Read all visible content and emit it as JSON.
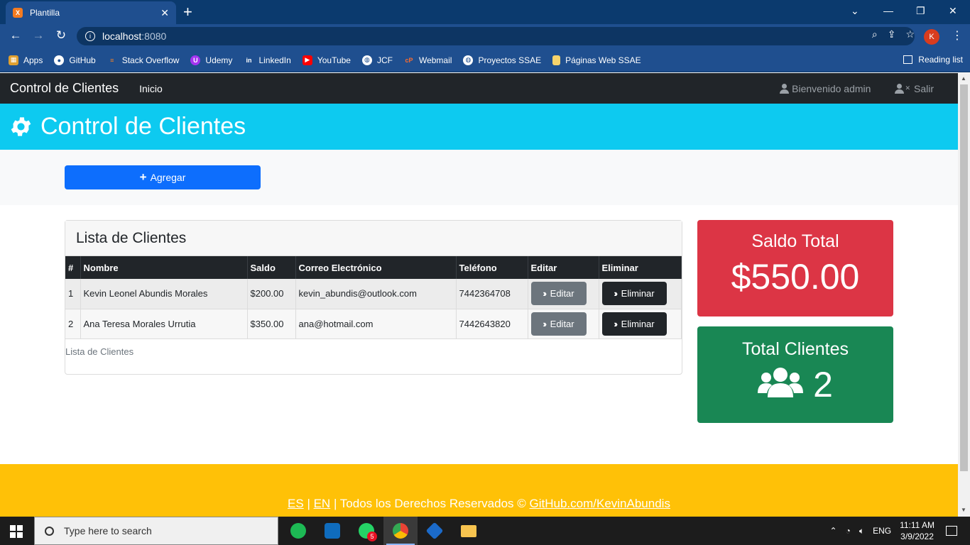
{
  "browser": {
    "tab_title": "Plantilla",
    "tab_favicon": "XAMPP",
    "url_host": "localhost",
    "url_port": ":8080",
    "avatar_letter": "K",
    "bookmarks": [
      {
        "label": "Apps",
        "icon": "apps-grid-icon",
        "color": "#e0a030"
      },
      {
        "label": "GitHub",
        "icon": "github-icon",
        "color": "#ffffff"
      },
      {
        "label": "Stack Overflow",
        "icon": "stackoverflow-icon",
        "color": "#f48024"
      },
      {
        "label": "Udemy",
        "icon": "udemy-icon",
        "color": "#a435f0"
      },
      {
        "label": "LinkedIn",
        "icon": "linkedin-icon",
        "color": "#0a66c2"
      },
      {
        "label": "YouTube",
        "icon": "youtube-icon",
        "color": "#ff0000"
      },
      {
        "label": "JCF",
        "icon": "globe-icon",
        "color": "#ffffff"
      },
      {
        "label": "Webmail",
        "icon": "cpanel-icon",
        "color": "#ff6c2c"
      },
      {
        "label": "Proyectos SSAE",
        "icon": "globe-icon",
        "color": "#ffffff"
      },
      {
        "label": "Páginas Web SSAE",
        "icon": "folder-icon",
        "color": "#f6d36b"
      }
    ],
    "reading_list": "Reading list"
  },
  "navbar": {
    "brand": "Control de Clientes",
    "home": "Inicio",
    "welcome": "Bienvenido admin",
    "logout": "Salir"
  },
  "hero": {
    "title": "Control de Clientes"
  },
  "actions": {
    "add_label": "Agregar"
  },
  "client_list": {
    "title": "Lista de Clientes",
    "columns": [
      "#",
      "Nombre",
      "Saldo",
      "Correo Electrónico",
      "Teléfono",
      "Editar",
      "Eliminar"
    ],
    "rows": [
      {
        "id": "1",
        "name": "Kevin Leonel Abundis Morales",
        "balance": "$200.00",
        "email": "kevin_abundis@outlook.com",
        "phone": "7442364708"
      },
      {
        "id": "2",
        "name": "Ana Teresa Morales Urrutia",
        "balance": "$350.00",
        "email": "ana@hotmail.com",
        "phone": "7442643820"
      }
    ],
    "edit_label": "Editar",
    "delete_label": "Eliminar",
    "footer": "Lista de Clientes"
  },
  "summary": {
    "balance_title": "Saldo Total",
    "balance_value": "$550.00",
    "clients_title": "Total Clientes",
    "clients_value": "2"
  },
  "footer": {
    "lang_es": "ES",
    "lang_en": "EN",
    "rights": "Todos los Derechos Reservados ©",
    "link": "GitHub.com/KevinAbundis"
  },
  "taskbar": {
    "search_placeholder": "Type here to search",
    "whatsapp_badge": "5",
    "lang": "ENG",
    "time": "11:11 AM",
    "date": "3/9/2022"
  },
  "colors": {
    "navbar": "#212529",
    "hero": "#0dcaf0",
    "primary": "#0d6efd",
    "danger": "#dc3545",
    "success": "#198754",
    "warning": "#ffc107",
    "secondary": "#6c757d"
  }
}
